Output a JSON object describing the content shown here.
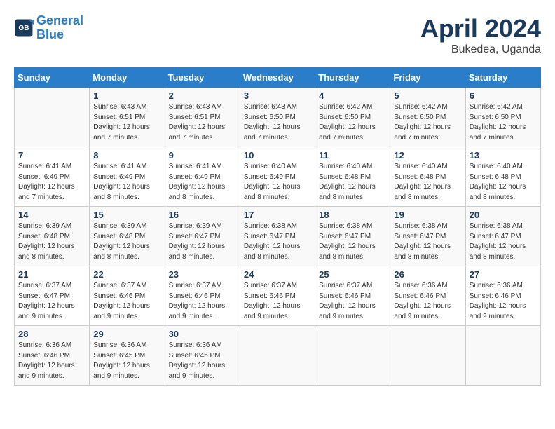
{
  "header": {
    "logo_line1": "General",
    "logo_line2": "Blue",
    "month": "April 2024",
    "location": "Bukedea, Uganda"
  },
  "days_of_week": [
    "Sunday",
    "Monday",
    "Tuesday",
    "Wednesday",
    "Thursday",
    "Friday",
    "Saturday"
  ],
  "weeks": [
    [
      {
        "day": "",
        "info": ""
      },
      {
        "day": "1",
        "info": "Sunrise: 6:43 AM\nSunset: 6:51 PM\nDaylight: 12 hours\nand 7 minutes."
      },
      {
        "day": "2",
        "info": "Sunrise: 6:43 AM\nSunset: 6:51 PM\nDaylight: 12 hours\nand 7 minutes."
      },
      {
        "day": "3",
        "info": "Sunrise: 6:43 AM\nSunset: 6:50 PM\nDaylight: 12 hours\nand 7 minutes."
      },
      {
        "day": "4",
        "info": "Sunrise: 6:42 AM\nSunset: 6:50 PM\nDaylight: 12 hours\nand 7 minutes."
      },
      {
        "day": "5",
        "info": "Sunrise: 6:42 AM\nSunset: 6:50 PM\nDaylight: 12 hours\nand 7 minutes."
      },
      {
        "day": "6",
        "info": "Sunrise: 6:42 AM\nSunset: 6:50 PM\nDaylight: 12 hours\nand 7 minutes."
      }
    ],
    [
      {
        "day": "7",
        "info": "Sunrise: 6:41 AM\nSunset: 6:49 PM\nDaylight: 12 hours\nand 7 minutes."
      },
      {
        "day": "8",
        "info": "Sunrise: 6:41 AM\nSunset: 6:49 PM\nDaylight: 12 hours\nand 8 minutes."
      },
      {
        "day": "9",
        "info": "Sunrise: 6:41 AM\nSunset: 6:49 PM\nDaylight: 12 hours\nand 8 minutes."
      },
      {
        "day": "10",
        "info": "Sunrise: 6:40 AM\nSunset: 6:49 PM\nDaylight: 12 hours\nand 8 minutes."
      },
      {
        "day": "11",
        "info": "Sunrise: 6:40 AM\nSunset: 6:48 PM\nDaylight: 12 hours\nand 8 minutes."
      },
      {
        "day": "12",
        "info": "Sunrise: 6:40 AM\nSunset: 6:48 PM\nDaylight: 12 hours\nand 8 minutes."
      },
      {
        "day": "13",
        "info": "Sunrise: 6:40 AM\nSunset: 6:48 PM\nDaylight: 12 hours\nand 8 minutes."
      }
    ],
    [
      {
        "day": "14",
        "info": "Sunrise: 6:39 AM\nSunset: 6:48 PM\nDaylight: 12 hours\nand 8 minutes."
      },
      {
        "day": "15",
        "info": "Sunrise: 6:39 AM\nSunset: 6:48 PM\nDaylight: 12 hours\nand 8 minutes."
      },
      {
        "day": "16",
        "info": "Sunrise: 6:39 AM\nSunset: 6:47 PM\nDaylight: 12 hours\nand 8 minutes."
      },
      {
        "day": "17",
        "info": "Sunrise: 6:38 AM\nSunset: 6:47 PM\nDaylight: 12 hours\nand 8 minutes."
      },
      {
        "day": "18",
        "info": "Sunrise: 6:38 AM\nSunset: 6:47 PM\nDaylight: 12 hours\nand 8 minutes."
      },
      {
        "day": "19",
        "info": "Sunrise: 6:38 AM\nSunset: 6:47 PM\nDaylight: 12 hours\nand 8 minutes."
      },
      {
        "day": "20",
        "info": "Sunrise: 6:38 AM\nSunset: 6:47 PM\nDaylight: 12 hours\nand 8 minutes."
      }
    ],
    [
      {
        "day": "21",
        "info": "Sunrise: 6:37 AM\nSunset: 6:47 PM\nDaylight: 12 hours\nand 9 minutes."
      },
      {
        "day": "22",
        "info": "Sunrise: 6:37 AM\nSunset: 6:46 PM\nDaylight: 12 hours\nand 9 minutes."
      },
      {
        "day": "23",
        "info": "Sunrise: 6:37 AM\nSunset: 6:46 PM\nDaylight: 12 hours\nand 9 minutes."
      },
      {
        "day": "24",
        "info": "Sunrise: 6:37 AM\nSunset: 6:46 PM\nDaylight: 12 hours\nand 9 minutes."
      },
      {
        "day": "25",
        "info": "Sunrise: 6:37 AM\nSunset: 6:46 PM\nDaylight: 12 hours\nand 9 minutes."
      },
      {
        "day": "26",
        "info": "Sunrise: 6:36 AM\nSunset: 6:46 PM\nDaylight: 12 hours\nand 9 minutes."
      },
      {
        "day": "27",
        "info": "Sunrise: 6:36 AM\nSunset: 6:46 PM\nDaylight: 12 hours\nand 9 minutes."
      }
    ],
    [
      {
        "day": "28",
        "info": "Sunrise: 6:36 AM\nSunset: 6:46 PM\nDaylight: 12 hours\nand 9 minutes."
      },
      {
        "day": "29",
        "info": "Sunrise: 6:36 AM\nSunset: 6:45 PM\nDaylight: 12 hours\nand 9 minutes."
      },
      {
        "day": "30",
        "info": "Sunrise: 6:36 AM\nSunset: 6:45 PM\nDaylight: 12 hours\nand 9 minutes."
      },
      {
        "day": "",
        "info": ""
      },
      {
        "day": "",
        "info": ""
      },
      {
        "day": "",
        "info": ""
      },
      {
        "day": "",
        "info": ""
      }
    ]
  ]
}
